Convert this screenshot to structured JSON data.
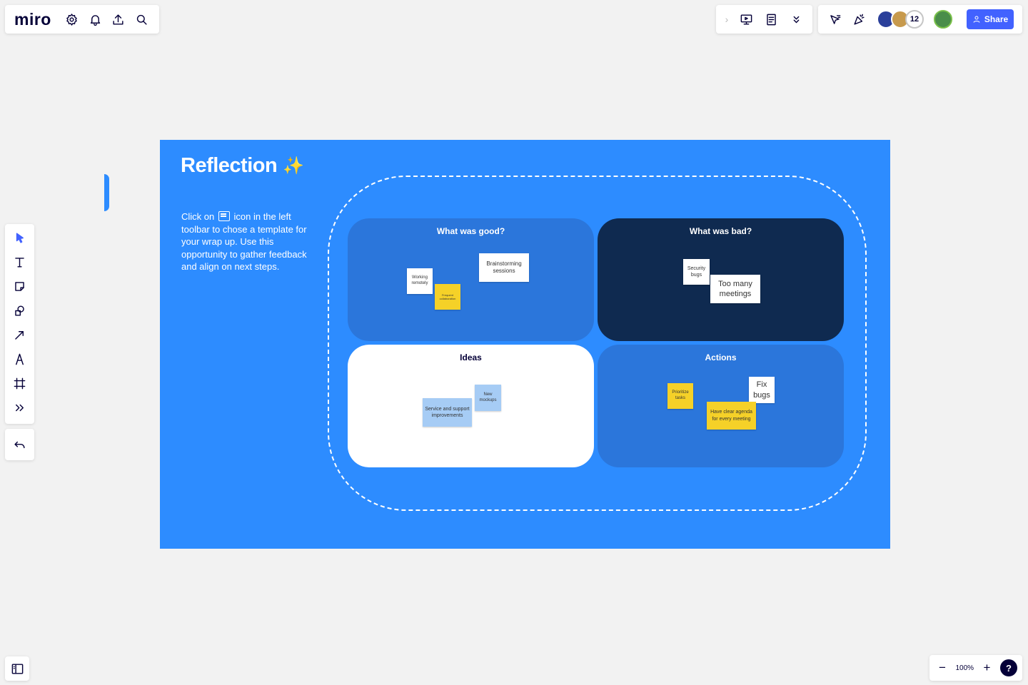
{
  "app": {
    "logo": "miro"
  },
  "top_right": {
    "participant_count": "12",
    "share_label": "Share"
  },
  "frame": {
    "title": "Reflection",
    "sparkle": "✨",
    "desc_before": "Click on",
    "desc_after": "icon in the left toolbar to chose a template for your wrap up. Use this opportunity to gather feedback and align on next steps."
  },
  "quadrants": [
    {
      "title": "What was good?"
    },
    {
      "title": "What was bad?"
    },
    {
      "title": "Ideas"
    },
    {
      "title": "Actions"
    }
  ],
  "stickies": {
    "working_remotely": "Working remotely",
    "frequent_collab": "Frequent collaboration",
    "brainstorming": "Brainstorming sessions",
    "security_bugs": "Security bugs",
    "too_many_meetings": "Too many meetings",
    "service_support": "Service and support improvements",
    "new_mockups": "New mockups",
    "prioritize_tasks": "Prioritize tasks",
    "fix_bugs": "Fix bugs",
    "clear_agenda": "Have clear agenda for every meeting"
  },
  "zoom": {
    "level": "100%",
    "help": "?"
  },
  "colors": {
    "frame": "#2d8cff",
    "accent": "#4262ff",
    "bad_quadrant": "#0f2a50",
    "sticky_yellow": "#f5d128",
    "sticky_blue": "#a6ccf5"
  }
}
